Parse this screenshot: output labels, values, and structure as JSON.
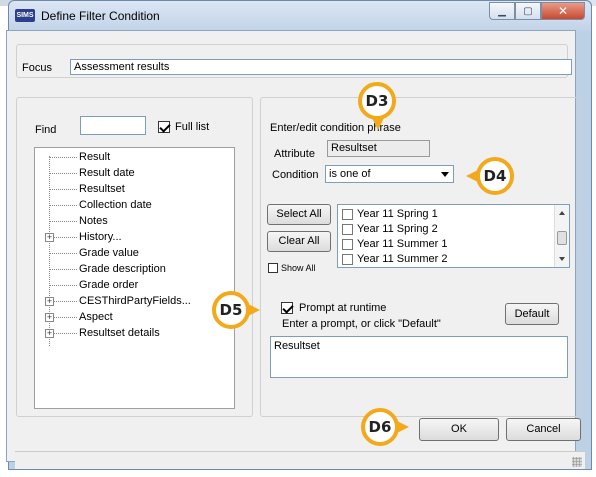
{
  "window": {
    "app_icon_text": "SIMS",
    "title": "Define Filter Condition",
    "minimize_glyph": "▁",
    "maximize_glyph": "▢",
    "close_glyph": "✕"
  },
  "focus": {
    "label": "Focus",
    "value": "Assessment results"
  },
  "left": {
    "find_label": "Find",
    "find_value": "",
    "full_list_label": "Full list",
    "full_list_checked": true,
    "tree": [
      {
        "label": "Result",
        "expandable": false
      },
      {
        "label": "Result date",
        "expandable": false
      },
      {
        "label": "Resultset",
        "expandable": false
      },
      {
        "label": "Collection date",
        "expandable": false
      },
      {
        "label": "Notes",
        "expandable": false
      },
      {
        "label": "History...",
        "expandable": true
      },
      {
        "label": "Grade value",
        "expandable": false
      },
      {
        "label": "Grade description",
        "expandable": false
      },
      {
        "label": "Grade order",
        "expandable": false
      },
      {
        "label": "CESThirdPartyFields...",
        "expandable": true
      },
      {
        "label": "Aspect",
        "expandable": true
      },
      {
        "label": "Resultset details",
        "expandable": true
      }
    ],
    "expand_glyph": "+"
  },
  "right": {
    "phrase_label": "Enter/edit condition phrase",
    "attribute_label": "Attribute",
    "attribute_value": "Resultset",
    "condition_label": "Condition",
    "condition_value": "is one of",
    "select_all_label": "Select All",
    "clear_all_label": "Clear All",
    "show_all_label": "Show All",
    "year_options": [
      {
        "label": "Year 11 Spring 1",
        "checked": false
      },
      {
        "label": "Year 11 Spring 2",
        "checked": false
      },
      {
        "label": "Year 11 Summer 1",
        "checked": false
      },
      {
        "label": "Year 11 Summer 2",
        "checked": false
      }
    ],
    "prompt_label": "Prompt at runtime",
    "prompt_checked": true,
    "prompt_hint": "Enter a prompt, or click \"Default\"",
    "default_label": "Default",
    "prompt_value": "Resultset"
  },
  "footer": {
    "ok_label": "OK",
    "cancel_label": "Cancel"
  },
  "callouts": {
    "d3": "D3",
    "d4": "D4",
    "d5": "D5",
    "d6": "D6",
    "color": "#f2a91c"
  }
}
